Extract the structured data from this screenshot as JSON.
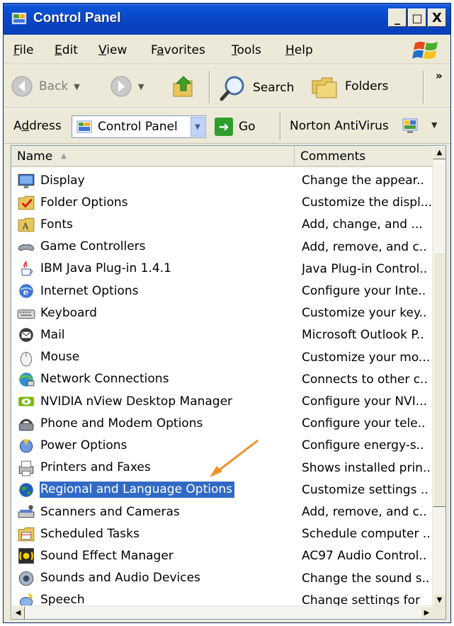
{
  "window": {
    "title": "Control Panel",
    "buttons": {
      "minimize": "_",
      "maximize": "□",
      "close": "X"
    }
  },
  "menu": {
    "items": [
      {
        "underline": "F",
        "rest": "ile"
      },
      {
        "underline": "E",
        "rest": "dit"
      },
      {
        "underline": "V",
        "rest": "iew"
      },
      {
        "pre": "F",
        "underline": "a",
        "rest": "vorites"
      },
      {
        "underline": "T",
        "rest": "ools"
      },
      {
        "underline": "H",
        "rest": "elp"
      }
    ]
  },
  "toolbar": {
    "back_label": "Back",
    "search_label": "Search",
    "folders_label": "Folders",
    "more": "»"
  },
  "address": {
    "label_pre": "A",
    "label_underline": "d",
    "label_rest": "dress",
    "value": "Control Panel",
    "go_label": "Go",
    "norton_label": "Norton AntiVirus"
  },
  "list": {
    "columns": {
      "name": "Name",
      "comments": "Comments"
    },
    "selected_index": 14,
    "items": [
      {
        "name": "Display",
        "comment": "Change the appear..",
        "icon": "display-icon"
      },
      {
        "name": "Folder Options",
        "comment": "Customize the displ...",
        "icon": "folder-options-icon"
      },
      {
        "name": "Fonts",
        "comment": "Add, change, and ...",
        "icon": "fonts-icon"
      },
      {
        "name": "Game Controllers",
        "comment": "Add, remove, and c..",
        "icon": "game-controller-icon"
      },
      {
        "name": "IBM Java Plug-in 1.4.1",
        "comment": "Java Plug-in Control..",
        "icon": "java-icon"
      },
      {
        "name": "Internet Options",
        "comment": "Configure your Inte..",
        "icon": "internet-options-icon"
      },
      {
        "name": "Keyboard",
        "comment": "Customize your key..",
        "icon": "keyboard-icon"
      },
      {
        "name": "Mail",
        "comment": "Microsoft Outlook P..",
        "icon": "mail-icon"
      },
      {
        "name": "Mouse",
        "comment": "Customize your mo...",
        "icon": "mouse-icon"
      },
      {
        "name": "Network Connections",
        "comment": "Connects to other c..",
        "icon": "network-icon"
      },
      {
        "name": "NVIDIA nView Desktop Manager",
        "comment": "Configure your NVI...",
        "icon": "nvidia-icon"
      },
      {
        "name": "Phone and Modem Options",
        "comment": "Configure your tele..",
        "icon": "phone-icon"
      },
      {
        "name": "Power Options",
        "comment": "Configure energy-s..",
        "icon": "power-icon"
      },
      {
        "name": "Printers and Faxes",
        "comment": "Shows installed prin..",
        "icon": "printer-icon"
      },
      {
        "name": "Regional and Language Options",
        "comment": "Customize settings ..",
        "icon": "globe-icon"
      },
      {
        "name": "Scanners and Cameras",
        "comment": "Add, remove, and c..",
        "icon": "scanner-icon"
      },
      {
        "name": "Scheduled Tasks",
        "comment": "Schedule computer ..",
        "icon": "scheduled-tasks-icon"
      },
      {
        "name": "Sound Effect Manager",
        "comment": "AC97 Audio Control..",
        "icon": "sound-effect-icon"
      },
      {
        "name": "Sounds and Audio Devices",
        "comment": "Change the sound s..",
        "icon": "speaker-icon"
      },
      {
        "name": "Speech",
        "comment": "Change settings for",
        "icon": "speech-icon"
      }
    ]
  },
  "colors": {
    "title_blue": "#0a52d6",
    "selection": "#316ac5",
    "chrome": "#ece9d8",
    "annotation_arrow": "#f0922e"
  }
}
